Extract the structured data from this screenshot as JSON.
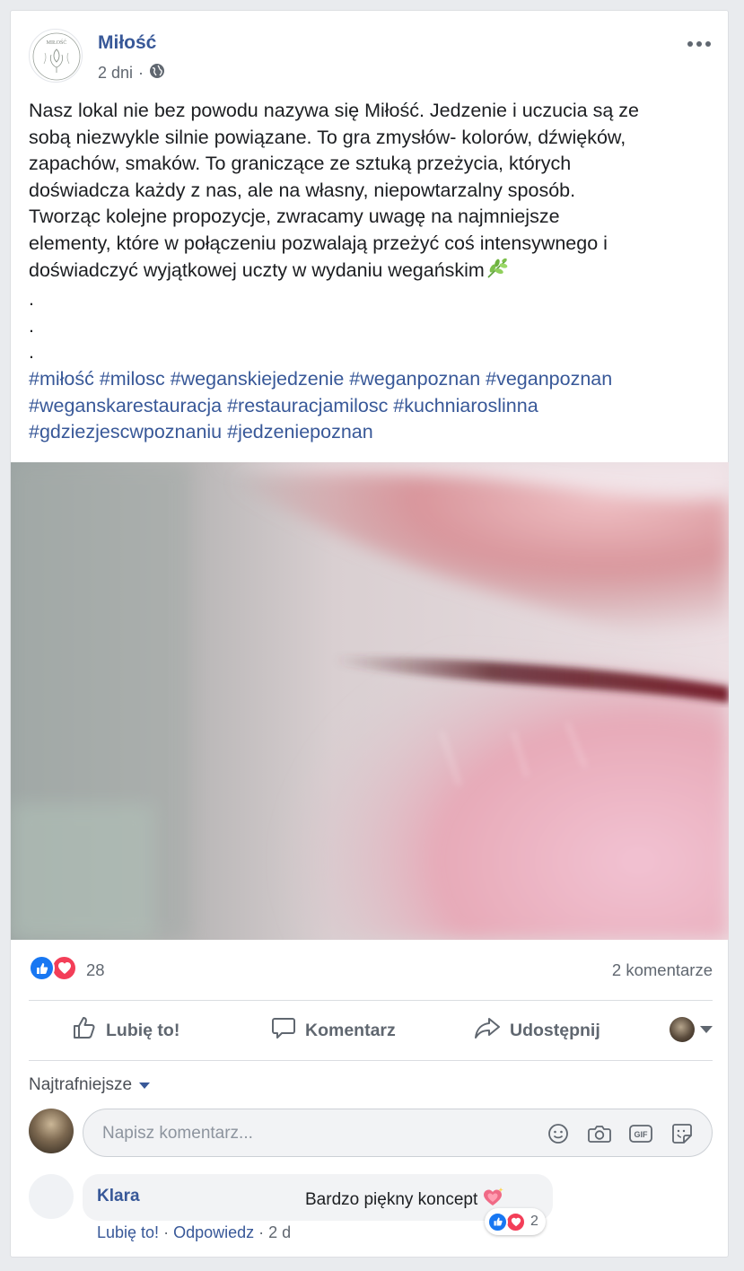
{
  "post": {
    "page_name": "Miłość",
    "time": "2 dni",
    "separator": "·",
    "audience_icon": "globe-icon",
    "avatar_logo_text": "MIŁOŚĆ",
    "text_lines": [
      "Nasz lokal nie bez powodu nazywa się Miłość. Jedzenie i uczucia są ze",
      "sobą niezwykle silnie powiązane. To gra zmysłów- kolorów, dźwięków,",
      "zapachów, smaków. To graniczące ze sztuką przeżycia, których",
      "doświadcza każdy z nas, ale na własny, niepowtarzalny sposób.",
      "Tworząc kolejne propozycje, zwracamy uwagę na najmniejsze",
      "elementy, które w połączeniu pozwalają przeżyć coś intensywnego i",
      "doświadczyć wyjątkowej uczty w wydaniu wegańskim"
    ],
    "dots": [
      ".",
      ".",
      "."
    ],
    "hashtag_lines": [
      "#miłość #milosc #weganskiejedzenie #weganpoznan #veganpoznan",
      "#weganskarestauracja #restauracjamilosc #kuchniaroslinna",
      "#gdziezjescwpoznaniu #jedzeniepoznan"
    ],
    "emoji": "herb-emoji",
    "photo_subject": "lips-closeup"
  },
  "stats": {
    "reaction_count": "28",
    "comment_count": "2 komentarze",
    "reactions": [
      "like-reaction",
      "love-reaction"
    ]
  },
  "actions": {
    "like": "Lubię to!",
    "comment": "Komentarz",
    "share": "Udostępnij"
  },
  "comments": {
    "sort_label": "Najtrafniejsze",
    "input_placeholder": "Napisz komentarz...",
    "items": [
      {
        "author": "Klara",
        "text": "Bardzo piękny koncept",
        "reaction_count": "2",
        "like_link": "Lubię to!",
        "reply_link": "Odpowiedz",
        "time": "2 d",
        "separator": "·"
      }
    ]
  },
  "colors": {
    "link": "#385898",
    "like_blue": "#1877f2",
    "love_red": "#f33e58",
    "secondary_text": "#606770"
  }
}
